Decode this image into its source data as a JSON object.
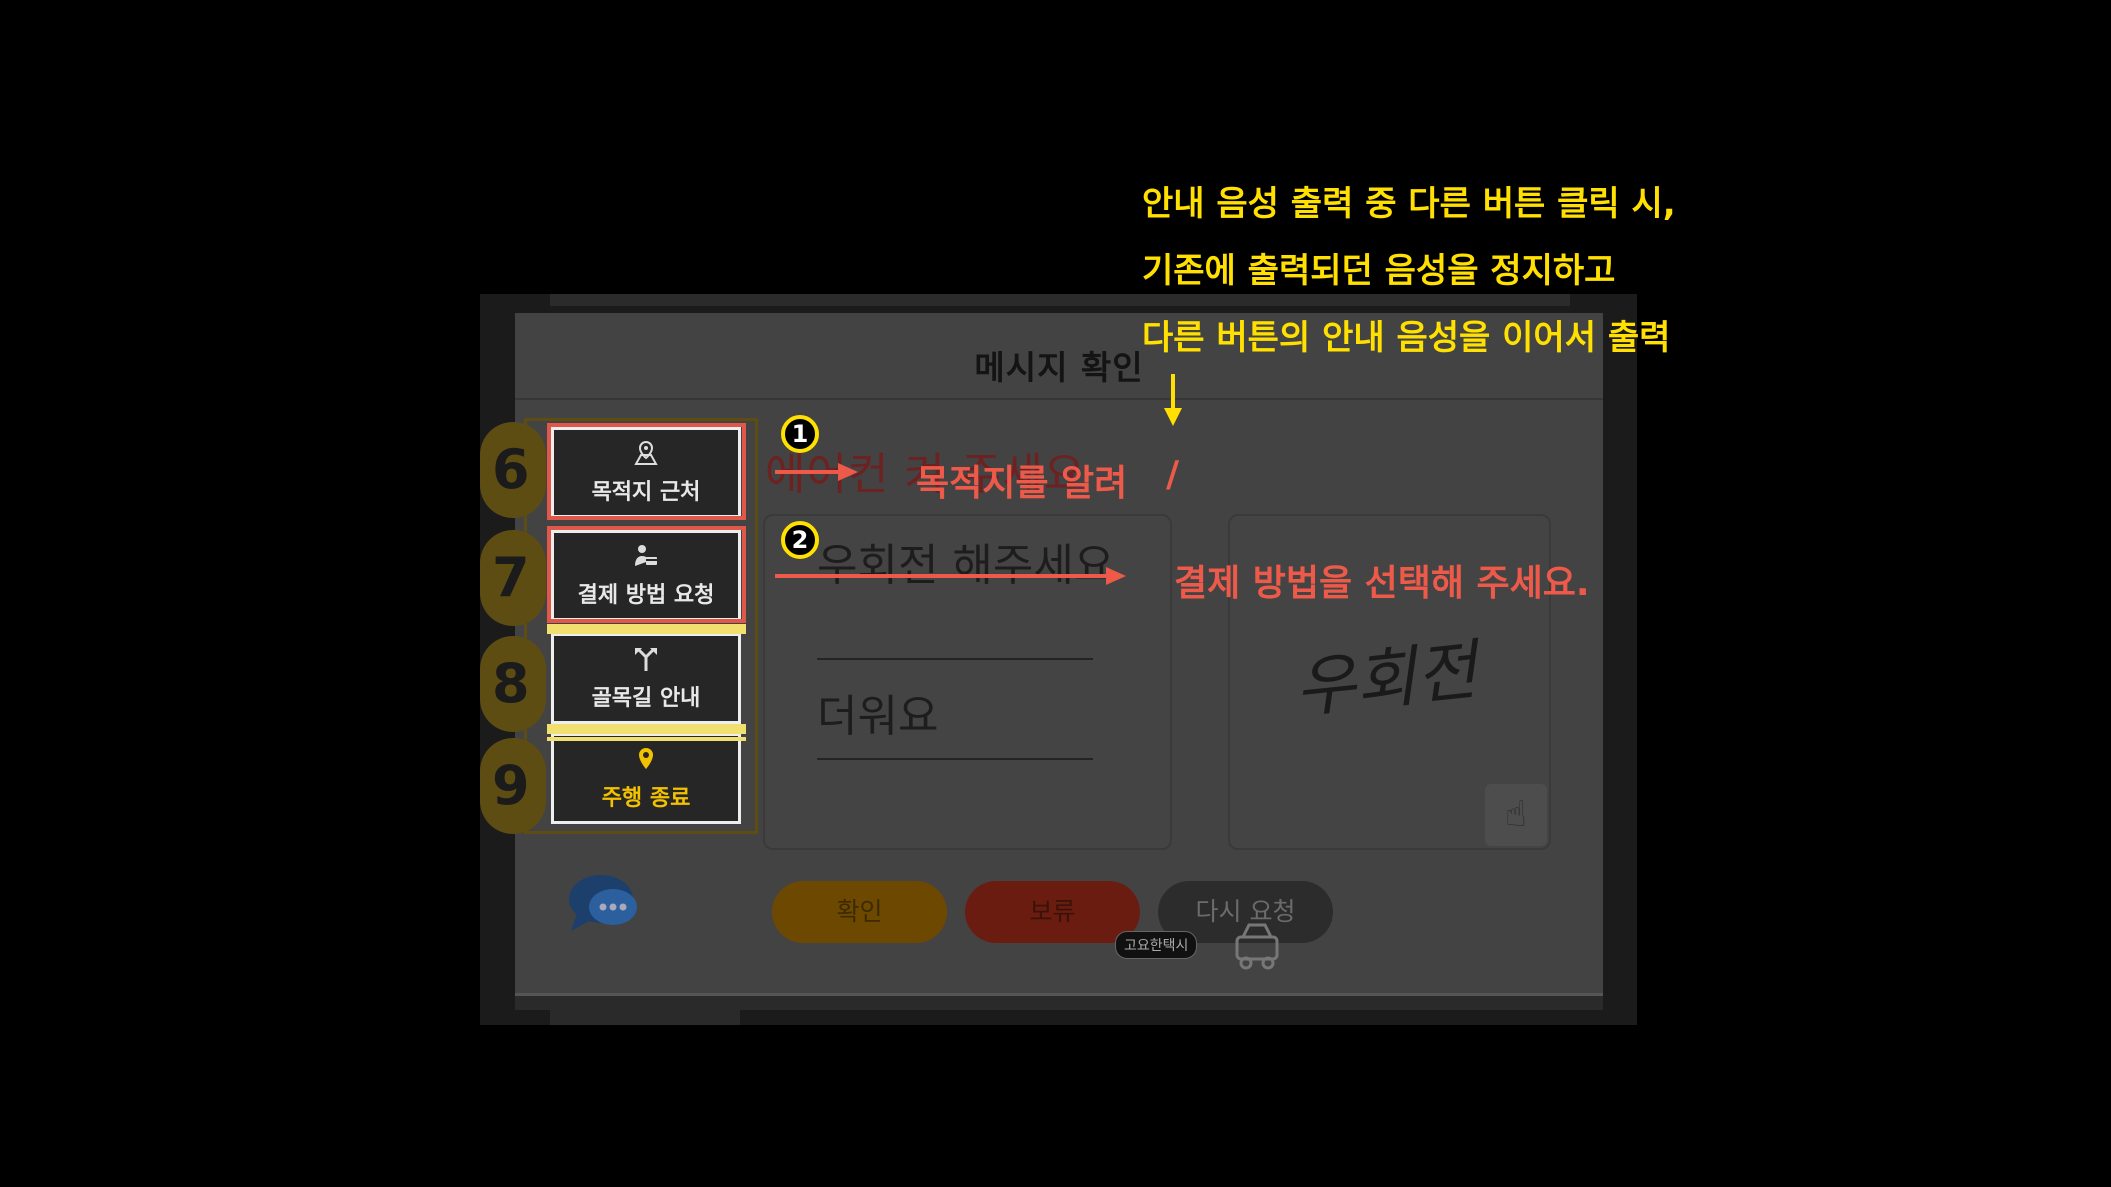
{
  "screen": {
    "title": "메시지 확인",
    "alert_text": "에어컨 켜 주세요",
    "message_1": "우회전 해주세요",
    "message_2": "더워요",
    "handwriting": "우회전",
    "buttons": {
      "confirm": "확인",
      "hold": "보류",
      "retry": "다시 요청"
    },
    "taxi_badge": "고요한택시"
  },
  "menu": [
    {
      "num": "6",
      "label": "목적지 근처",
      "icon": "map-pin-destination-icon"
    },
    {
      "num": "7",
      "label": "결제 방법 요청",
      "icon": "payment-icon"
    },
    {
      "num": "8",
      "label": "골목길 안내",
      "icon": "alley-directions-icon"
    },
    {
      "num": "9",
      "label": "주행 종료",
      "icon": "location-pin-icon"
    }
  ],
  "annotation": {
    "caption_lines": [
      "안내 음성 출력 중 다른 버튼 클릭 시,",
      "기존에 출력되던 음성을 정지하고",
      "다른 버튼의 안내 음성을 이어서 출력"
    ],
    "step1_num": "1",
    "step1_text": "목적지를 알려",
    "slash": "/",
    "step2_num": "2",
    "step2_text": "결제 방법을 선택해 주세요."
  },
  "colors": {
    "annotation_yellow": "#ffe000",
    "annotation_red": "#ee5a4a",
    "highlight_red": "#e0584a",
    "highlight_yellow": "#f1e070"
  }
}
